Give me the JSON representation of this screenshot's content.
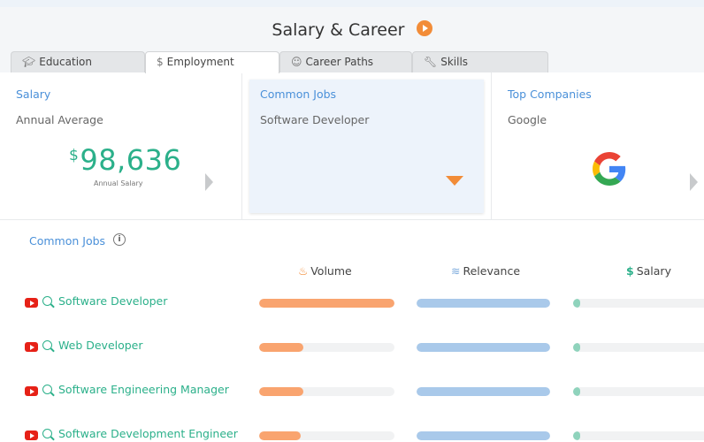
{
  "header": {
    "title": "Salary & Career",
    "accent_color": "#f28c38"
  },
  "tabs": [
    {
      "label": "Education",
      "icon": "graduation-cap-icon",
      "active": false
    },
    {
      "label": "Employment",
      "icon": "dollar-icon",
      "active": true
    },
    {
      "label": "Career Paths",
      "icon": "person-icon",
      "active": false
    },
    {
      "label": "Skills",
      "icon": "wrench-icon",
      "active": false
    }
  ],
  "cards": {
    "salary": {
      "title": "Salary",
      "subtitle": "Annual Average",
      "currency": "$",
      "value": "98,636",
      "caption": "Annual Salary"
    },
    "common_jobs": {
      "title": "Common Jobs",
      "subtitle": "Software Developer"
    },
    "top_companies": {
      "title": "Top Companies",
      "subtitle": "Google",
      "logo": "google-logo"
    }
  },
  "section": {
    "title": "Common Jobs",
    "info": "i"
  },
  "columns": {
    "volume": {
      "label": "Volume",
      "icon": "flame-icon",
      "color": "#f9a46f"
    },
    "relevance": {
      "label": "Relevance",
      "icon": "network-icon",
      "color": "#a9c9ea"
    },
    "salary": {
      "label": "Salary",
      "icon": "$",
      "color": "#8fd3bc"
    }
  },
  "jobs": [
    {
      "name": "Software Developer",
      "volume": 1.0,
      "relevance": 1.0,
      "salary": 0.05
    },
    {
      "name": "Web Developer",
      "volume": 0.33,
      "relevance": 1.0,
      "salary": 0.05
    },
    {
      "name": "Software Engineering Manager",
      "volume": 0.33,
      "relevance": 1.0,
      "salary": 0.05
    },
    {
      "name": "Software Development Engineer",
      "volume": 0.31,
      "relevance": 1.0,
      "salary": 0.05
    }
  ],
  "colors": {
    "link_green": "#2bb08a",
    "title_blue": "#4a90d9",
    "youtube_red": "#e62117"
  }
}
